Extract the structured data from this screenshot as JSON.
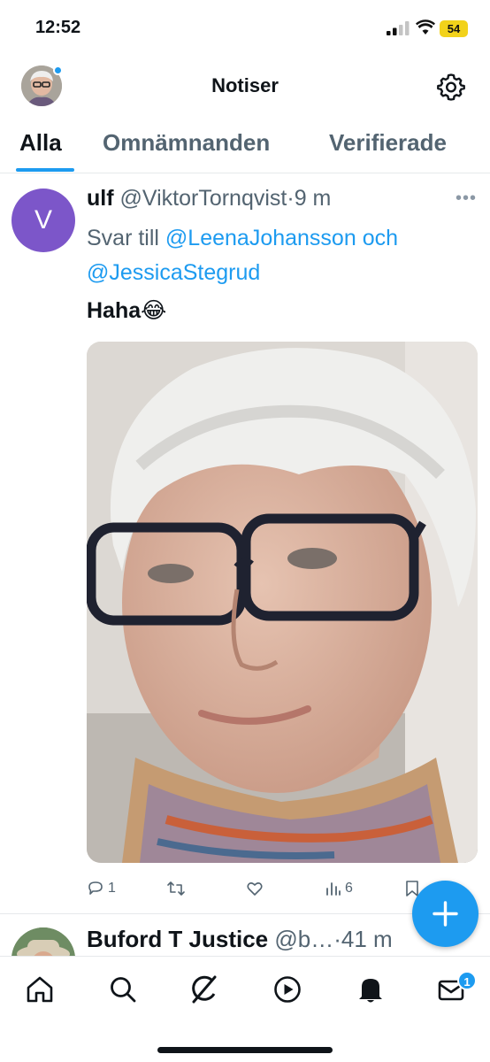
{
  "status_bar": {
    "time": "12:52",
    "battery": "54"
  },
  "header": {
    "title": "Notiser",
    "avatar": "profile-photo",
    "settings_icon": "gear-icon"
  },
  "tabs": [
    {
      "label": "Alla",
      "active": true
    },
    {
      "label": "Omnämnanden",
      "active": false
    },
    {
      "label": "Verifierade",
      "active": false
    }
  ],
  "tweet": {
    "avatar_letter": "V",
    "avatar_color": "#7c56c9",
    "name": "ulf",
    "handle": "@ViktorTornqvist",
    "separator": "·",
    "time": "9 m",
    "reply_prefix": "Svar till",
    "reply_user1": "@LeenaJohansson",
    "reply_and": "och",
    "reply_user2": "@JessicaStegrud",
    "text": "Haha😂",
    "actions": {
      "replies": "1",
      "views": "6"
    }
  },
  "tweet2": {
    "name": "Buford T Justice",
    "handle": "@b…",
    "separator": "·",
    "time": "41 m"
  },
  "bottom_nav": {
    "items": [
      "home-icon",
      "search-icon",
      "grok-icon",
      "video-icon",
      "bell-icon",
      "mail-icon"
    ],
    "messages_badge": "1"
  },
  "colors": {
    "accent": "#1d9bf0",
    "text": "#0f1419",
    "muted": "#536471"
  }
}
